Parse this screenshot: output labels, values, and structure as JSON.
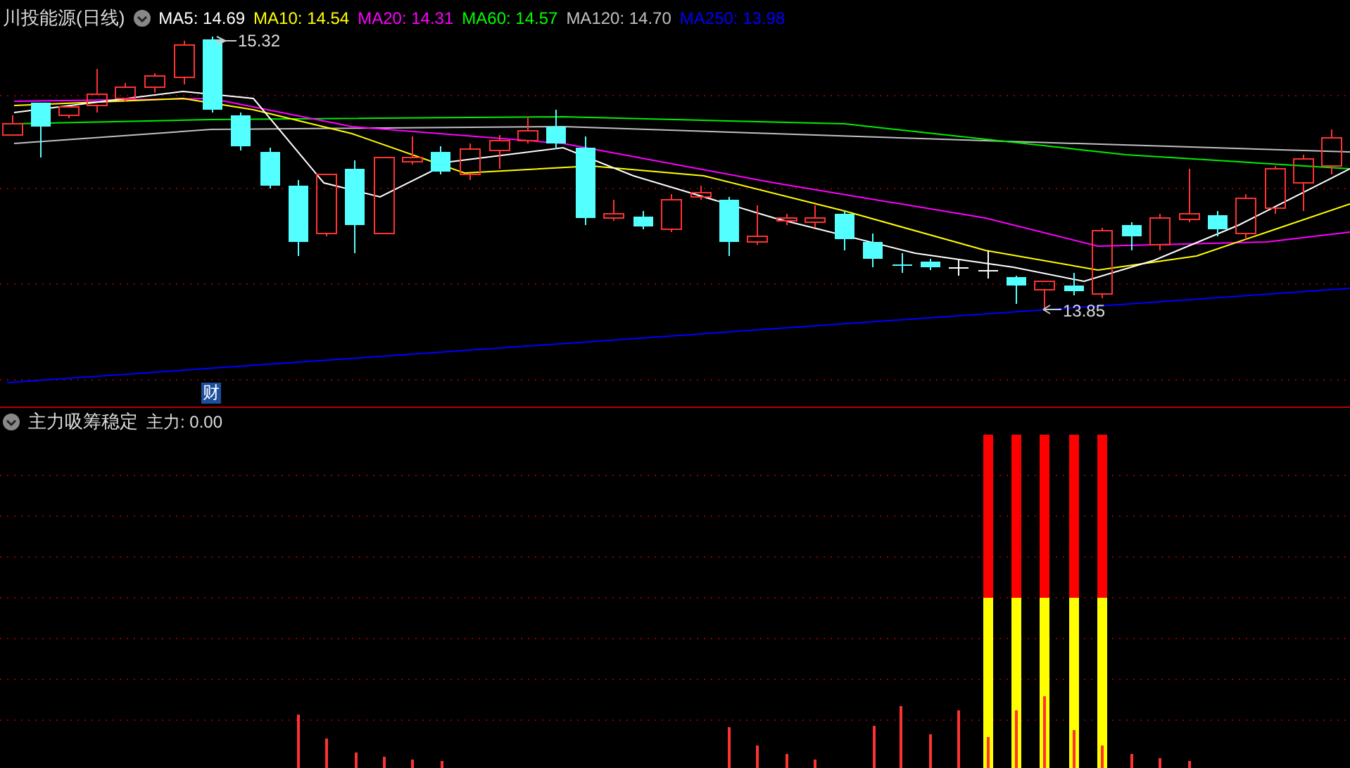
{
  "main_chart": {
    "title": "川投能源(日线)",
    "ma_legend": [
      {
        "label": "MA5:",
        "value": "14.69",
        "color": "#ffffff"
      },
      {
        "label": "MA10:",
        "value": "14.54",
        "color": "#ffff00"
      },
      {
        "label": "MA20:",
        "value": "14.31",
        "color": "#ff00ff"
      },
      {
        "label": "MA60:",
        "value": "14.57",
        "color": "#00ff00"
      },
      {
        "label": "MA120:",
        "value": "14.70",
        "color": "#c0c0c0"
      },
      {
        "label": "MA250:",
        "value": "13.98",
        "color": "#0000ff"
      }
    ],
    "high_marker": "15.32",
    "low_marker": "13.85",
    "event_badge": "财"
  },
  "indicator_panel": {
    "title": "主力吸筹稳定",
    "reading": "主力: 0.00"
  }
}
